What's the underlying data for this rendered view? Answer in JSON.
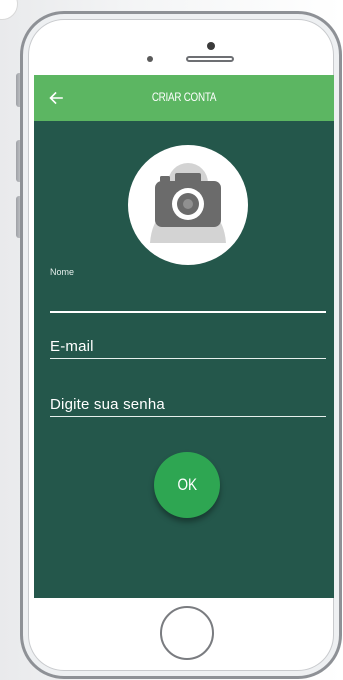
{
  "app": {
    "title": "CRIAR CONTA",
    "back_icon": "arrow-left-icon",
    "avatar_icon": "camera-icon"
  },
  "form": {
    "nome_label": "Nome",
    "nome_value": "",
    "email_placeholder": "E-mail",
    "senha_placeholder": "Digite sua senha",
    "submit_label": "OK"
  },
  "colors": {
    "appbar": "#5cb662",
    "background": "#24574b",
    "button": "#2ea652"
  }
}
